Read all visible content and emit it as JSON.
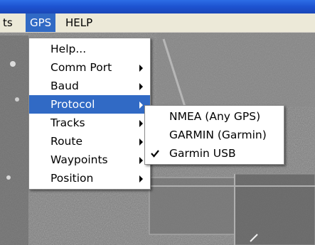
{
  "window": {
    "title_fragment": ""
  },
  "menubar": {
    "items": [
      {
        "label": "ts"
      },
      {
        "label": "GPS"
      },
      {
        "label": "HELP"
      }
    ]
  },
  "gps_menu": {
    "items": [
      {
        "label": "Help...",
        "has_submenu": false
      },
      {
        "label": "Comm Port",
        "has_submenu": true
      },
      {
        "label": "Baud",
        "has_submenu": true
      },
      {
        "label": "Protocol",
        "has_submenu": true,
        "highlighted": true
      },
      {
        "label": "Tracks",
        "has_submenu": true
      },
      {
        "label": "Route",
        "has_submenu": true
      },
      {
        "label": "Waypoints",
        "has_submenu": true
      },
      {
        "label": "Position",
        "has_submenu": true
      }
    ]
  },
  "protocol_submenu": {
    "items": [
      {
        "label": "NMEA (Any GPS)",
        "checked": false
      },
      {
        "label": "GARMIN (Garmin)",
        "checked": false
      },
      {
        "label": "Garmin USB",
        "checked": true
      }
    ]
  },
  "colors": {
    "highlight": "#316ac5",
    "menubar": "#ece9d8",
    "titlebar": "#1d52d0"
  },
  "icons": {
    "submenu_arrow": "triangle-right-icon",
    "check": "checkmark-icon"
  }
}
